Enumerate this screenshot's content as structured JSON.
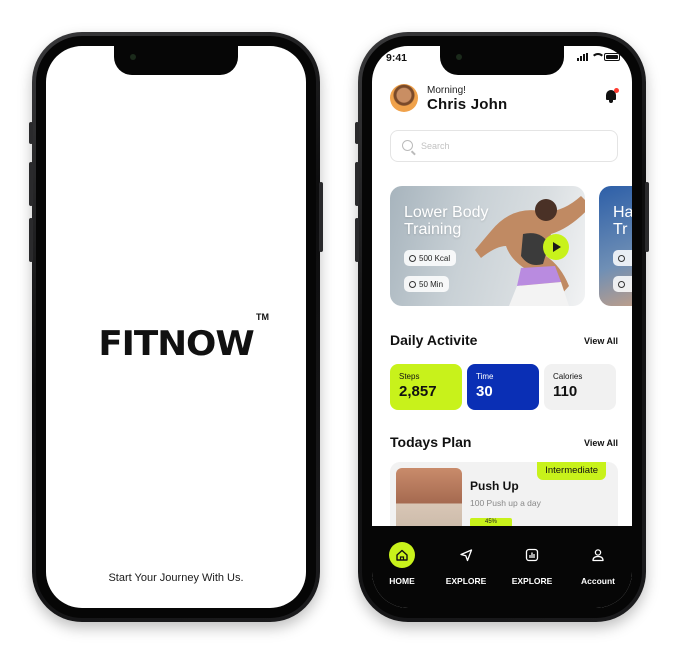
{
  "splash": {
    "logo": "FITNOW",
    "trademark": "TM",
    "tagline": "Start Your Journey With Us."
  },
  "home": {
    "status_time": "9:41",
    "greeting": "Morning!",
    "user_name": "Chris John",
    "search_placeholder": "Search",
    "workouts": [
      {
        "title_line1": "Lower Body",
        "title_line2": "Training",
        "kcal": "500 Kcal",
        "duration": "50 Min"
      },
      {
        "title_line1": "Ha",
        "title_line2": "Tr",
        "kcal": "",
        "duration": ""
      }
    ],
    "daily_activity": {
      "title": "Daily Activite",
      "view_all": "View All",
      "stats": [
        {
          "label": "Steps",
          "value": "2,857",
          "bg": "#c8f21b",
          "fg": "#111111"
        },
        {
          "label": "Time",
          "value": "30",
          "bg": "#0a2fb5",
          "fg": "#ffffff"
        },
        {
          "label": "Calories",
          "value": "110",
          "bg": "#f1f1f1",
          "fg": "#111111"
        }
      ]
    },
    "todays_plan": {
      "title": "Todays Plan",
      "view_all": "View All",
      "item": {
        "name": "Push Up",
        "subtitle": "100 Push up a day",
        "progress_label": "45%",
        "progress": 0.45,
        "level": "Intermediate"
      }
    },
    "tabs": [
      {
        "label": "HOME",
        "icon": "home-icon",
        "active": true
      },
      {
        "label": "EXPLORE",
        "icon": "send-icon",
        "active": false
      },
      {
        "label": "EXPLORE",
        "icon": "chart-icon",
        "active": false
      },
      {
        "label": "Account",
        "icon": "user-icon",
        "active": false
      }
    ],
    "accent_color": "#c8f21b"
  }
}
